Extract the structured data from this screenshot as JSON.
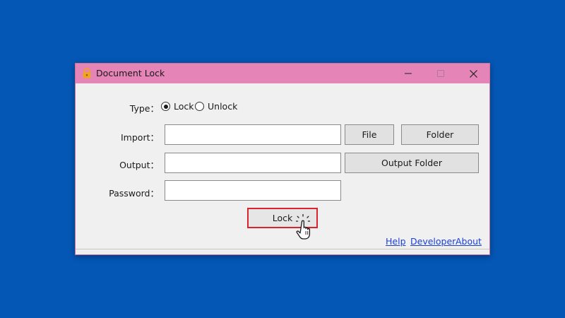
{
  "window": {
    "title": "Document Lock",
    "controls": {
      "minimize": "minimize-icon",
      "maximize": "maximize-icon",
      "close": "close-icon"
    }
  },
  "type_row": {
    "label": "Type：",
    "options": [
      {
        "label": "Lock",
        "selected": true
      },
      {
        "label": "Unlock",
        "selected": false
      }
    ]
  },
  "import_row": {
    "label": "Import：",
    "value": "",
    "file_button": "File",
    "folder_button": "Folder"
  },
  "output_row": {
    "label": "Output：",
    "value": "",
    "output_folder_button": "Output Folder"
  },
  "password_row": {
    "label": "Password：",
    "value": ""
  },
  "action_button": "Lock",
  "links": {
    "help": "Help",
    "developer": "Developer",
    "about": "About"
  },
  "colors": {
    "desktop": "#0457b5",
    "titlebar": "#e584b7",
    "window_body": "#f0f0f0",
    "lock_button_border": "#d9262e",
    "link": "#1a3fd6",
    "app_icon": "#f2a51b"
  },
  "icons": {
    "app": "padlock-icon",
    "pointer": "hand-pointer-icon"
  }
}
